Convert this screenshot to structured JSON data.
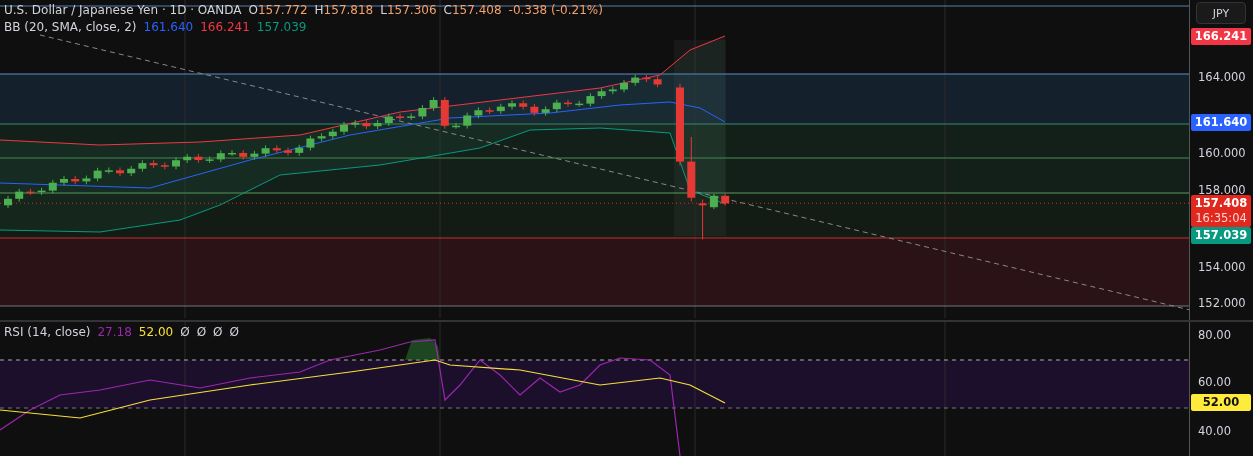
{
  "legend": {
    "symbol": "U.S. Dollar / Japanese Yen · 1D · OANDA",
    "ohlc": [
      {
        "label": "O",
        "value": "157.772"
      },
      {
        "label": "H",
        "value": "157.818"
      },
      {
        "label": "L",
        "value": "157.306"
      },
      {
        "label": "C",
        "value": "157.408"
      }
    ],
    "change": "-0.338 (-0.21%)"
  },
  "bb_legend": {
    "name": "BB (20, SMA, close, 2)",
    "values": [
      {
        "text": "161.640",
        "color": "#2962ff"
      },
      {
        "text": "166.241",
        "color": "#f23645"
      },
      {
        "text": "157.039",
        "color": "#089981"
      }
    ]
  },
  "currency_button": "JPY",
  "price_axis": {
    "ticks": [
      "164.000",
      "160.000",
      "158.000",
      "154.000",
      "152.000"
    ],
    "tags": [
      {
        "lines": [
          "166.241"
        ],
        "color": "#f23645"
      },
      {
        "lines": [
          "161.640"
        ],
        "color": "#2962ff"
      },
      {
        "lines": [
          "157.408",
          "16:35:04"
        ],
        "color": "#e0281e"
      },
      {
        "lines": [
          "157.039"
        ],
        "color": "#089981"
      }
    ]
  },
  "rsi_legend": {
    "name": "RSI (14, close)",
    "values": [
      {
        "text": "27.18",
        "color": "#9c27b0"
      },
      {
        "text": "52.00",
        "color": "#f7e03a"
      }
    ],
    "extras": [
      "Ø",
      "Ø",
      "Ø",
      "Ø"
    ]
  },
  "rsi_axis": {
    "ticks": [
      "80.00",
      "60.00",
      "40.00"
    ],
    "tags": [
      {
        "text": "52.00",
        "color": "#ffeb3b"
      }
    ]
  }
}
